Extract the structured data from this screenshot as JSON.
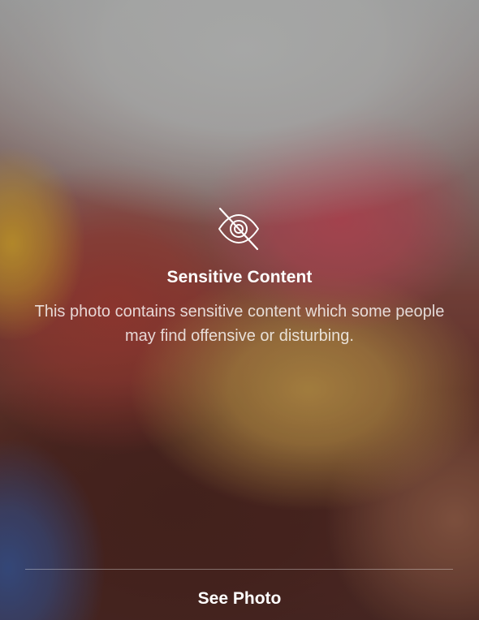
{
  "warning": {
    "icon": "eye-slash-icon",
    "title": "Sensitive Content",
    "description": "This photo contains sensitive content which some people may find offensive or disturbing."
  },
  "actions": {
    "see_photo_label": "See Photo"
  }
}
